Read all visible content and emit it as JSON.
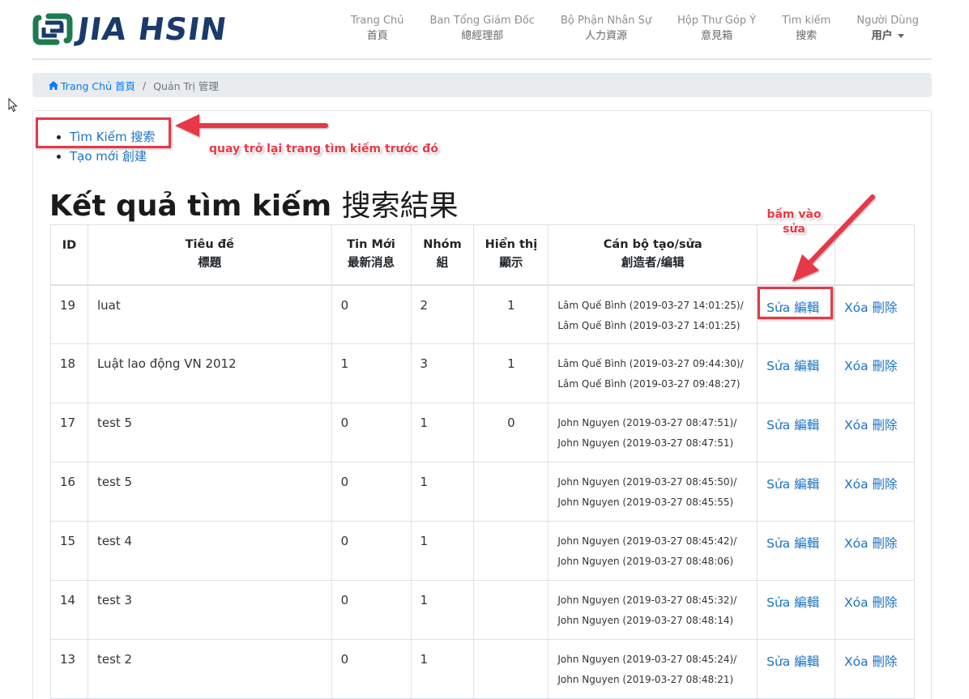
{
  "header": {
    "logo_text": "JIA HSIN",
    "nav": [
      {
        "label": "Trang Chủ",
        "sub": "首頁"
      },
      {
        "label": "Ban Tổng Giám Đốc",
        "sub": "總經理部"
      },
      {
        "label": "Bộ Phận Nhân Sự",
        "sub": "人力資源"
      },
      {
        "label": "Hộp Thư Góp Ý",
        "sub": "意見箱"
      },
      {
        "label": "Tìm kiếm",
        "sub": "搜索"
      },
      {
        "label": "Người Dùng",
        "sub": "用户"
      }
    ]
  },
  "breadcrumb": {
    "home": "Trang Chủ 首頁",
    "separator": "/",
    "current": "Quản Trị 管理"
  },
  "links": {
    "search": "Tìm Kiếm 搜索",
    "create": "Tạo mới 創建"
  },
  "page": {
    "title_vi": "Kết quả tìm kiếm",
    "title_zh": "搜索結果"
  },
  "table": {
    "headers": [
      {
        "line1": "ID",
        "line2": ""
      },
      {
        "line1": "Tiêu đề",
        "line2": "標題"
      },
      {
        "line1": "Tin Mới",
        "line2": "最新消息"
      },
      {
        "line1": "Nhóm",
        "line2": "組"
      },
      {
        "line1": "Hiển thị",
        "line2": "顯示"
      },
      {
        "line1": "Cán bộ tạo/sửa",
        "line2": "創造者/编辑"
      },
      {
        "line1": "",
        "line2": ""
      },
      {
        "line1": "",
        "line2": ""
      }
    ],
    "edit_label": "Sửa 編輯",
    "delete_label": "Xóa 刪除",
    "rows": [
      {
        "id": "19",
        "title": "luat",
        "news": "0",
        "group": "2",
        "show": "1",
        "creator1": "Lâm Quế Bình (2019-03-27 14:01:25)/",
        "creator2": "Lâm Quế Bình (2019-03-27 14:01:25)"
      },
      {
        "id": "18",
        "title": "Luật lao động VN 2012",
        "news": "1",
        "group": "3",
        "show": "1",
        "creator1": "Lâm Quế Bình (2019-03-27 09:44:30)/",
        "creator2": "Lâm Quế Bình (2019-03-27 09:48:27)"
      },
      {
        "id": "17",
        "title": "test 5",
        "news": "0",
        "group": "1",
        "show": "0",
        "creator1": "John Nguyen (2019-03-27 08:47:51)/",
        "creator2": "John Nguyen (2019-03-27 08:47:51)"
      },
      {
        "id": "16",
        "title": "test 5",
        "news": "0",
        "group": "1",
        "show": "",
        "creator1": "John Nguyen (2019-03-27 08:45:50)/",
        "creator2": "John Nguyen (2019-03-27 08:45:55)"
      },
      {
        "id": "15",
        "title": "test 4",
        "news": "0",
        "group": "1",
        "show": "",
        "creator1": "John Nguyen (2019-03-27 08:45:42)/",
        "creator2": "John Nguyen (2019-03-27 08:48:06)"
      },
      {
        "id": "14",
        "title": "test 3",
        "news": "0",
        "group": "1",
        "show": "",
        "creator1": "John Nguyen (2019-03-27 08:45:32)/",
        "creator2": "John Nguyen (2019-03-27 08:48:14)"
      },
      {
        "id": "13",
        "title": "test 2",
        "news": "0",
        "group": "1",
        "show": "",
        "creator1": "John Nguyen (2019-03-27 08:45:24)/",
        "creator2": "John Nguyen (2019-03-27 08:48:21)"
      }
    ]
  },
  "annotations": {
    "back_note": "quay trở lại trang tìm kiếm trước đó",
    "edit_note_line1": "bấm vào",
    "edit_note_line2": "sửa",
    "color": "#e63946"
  },
  "colors": {
    "link": "#1a73c8",
    "logo_green": "#1e7a4f",
    "logo_navy": "#1a3a6b"
  }
}
